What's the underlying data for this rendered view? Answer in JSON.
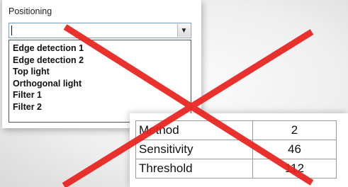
{
  "panel": {
    "group_label": "Positioning",
    "combo": {
      "value": ""
    },
    "dropdown_items": [
      "Edge detection 1",
      "Edge detection 2",
      "Top light",
      "Orthogonal light",
      "Filter 1",
      "Filter 2"
    ]
  },
  "table": {
    "rows": [
      {
        "name": "Method",
        "value": "2"
      },
      {
        "name": "Sensitivity",
        "value": "46"
      },
      {
        "name": "Threshold",
        "value": "112"
      }
    ]
  },
  "overlay": {
    "icon": "red-cross-icon",
    "color": "#e8231f"
  },
  "colors": {
    "combo_border": "#7a9cc4",
    "dropdown_border": "#555555"
  }
}
